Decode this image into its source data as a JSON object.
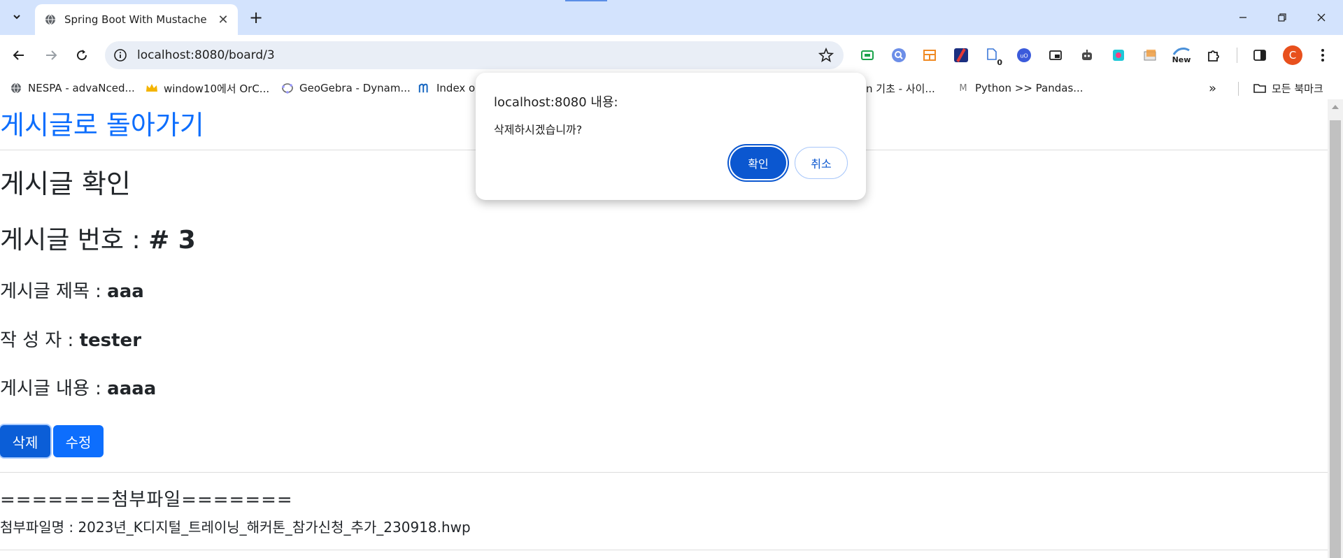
{
  "browser": {
    "tab_title": "Spring Boot With Mustache",
    "url": "localhost:8080/board/3",
    "profile_initial": "C",
    "extension_badge": "0",
    "extension_new_label": "New",
    "bookmarks": [
      {
        "label": "NESPA - advaNced...",
        "icon": "globe-icon"
      },
      {
        "label": "window10에서 OrC...",
        "icon": "crown-icon"
      },
      {
        "label": "GeoGebra - Dynam...",
        "icon": "geogebra-icon"
      },
      {
        "label": "Index o",
        "icon": "m-logo-icon"
      },
      {
        "label": "n 기초 - 사이...",
        "icon": "none"
      },
      {
        "label": "Python >> Pandas...",
        "icon": "m-letter-icon"
      }
    ],
    "all_bookmarks_label": "모든 북마크"
  },
  "page": {
    "back_link": "게시글로 돌아가기",
    "heading_confirm": "게시글 확인",
    "number_label": "게시글 번호 : ",
    "number_value": "# 3",
    "title_label": "게시글 제목 : ",
    "title_value": "aaa",
    "writer_label": "작 성 자 : ",
    "writer_value": "tester",
    "content_label": "게시글 내용 : ",
    "content_value": "aaaa",
    "delete_button": "삭제",
    "edit_button": "수정",
    "attachment_header": "=======첨부파일=======",
    "attachment_label": "첨부파일명 : ",
    "attachment_name": "2023년_K디지털_트레이닝_해커톤_참가신청_추가_230918.hwp"
  },
  "dialog": {
    "title": "localhost:8080 내용:",
    "message": "삭제하시겠습니까?",
    "ok_label": "확인",
    "cancel_label": "취소"
  },
  "colors": {
    "link_blue": "#0d6efd",
    "dialog_primary": "#0b57d0",
    "tabstrip_bg": "#d3e3fd"
  }
}
